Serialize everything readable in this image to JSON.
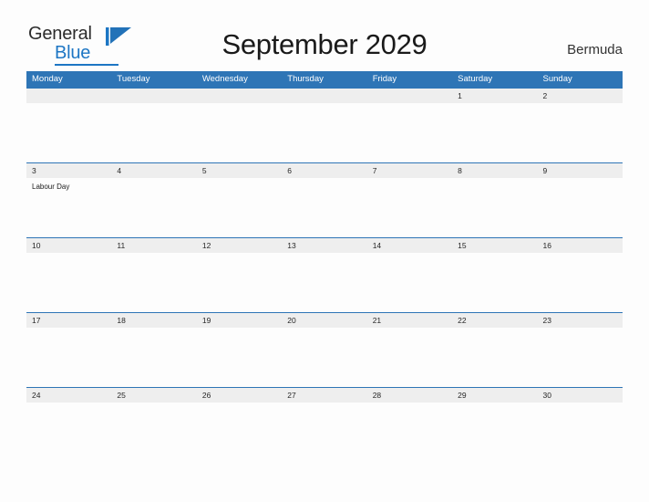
{
  "brand": {
    "word_one": "General",
    "word_two": "Blue",
    "flag_icon": "blue-triangle-flag",
    "color_blue": "#1d76c4",
    "color_dark": "#2b2b2b"
  },
  "header": {
    "title": "September 2029",
    "location": "Bermuda"
  },
  "theme": {
    "header_blue": "#2e75b6",
    "date_band_gray": "#eeeeee",
    "page_background": "#fdfdfd"
  },
  "calendar": {
    "weekdays": [
      "Monday",
      "Tuesday",
      "Wednesday",
      "Thursday",
      "Friday",
      "Saturday",
      "Sunday"
    ],
    "weeks": [
      {
        "dates": [
          "",
          "",
          "",
          "",
          "",
          "1",
          "2"
        ],
        "events": [
          "",
          "",
          "",
          "",
          "",
          "",
          ""
        ]
      },
      {
        "dates": [
          "3",
          "4",
          "5",
          "6",
          "7",
          "8",
          "9"
        ],
        "events": [
          "Labour Day",
          "",
          "",
          "",
          "",
          "",
          ""
        ]
      },
      {
        "dates": [
          "10",
          "11",
          "12",
          "13",
          "14",
          "15",
          "16"
        ],
        "events": [
          "",
          "",
          "",
          "",
          "",
          "",
          ""
        ]
      },
      {
        "dates": [
          "17",
          "18",
          "19",
          "20",
          "21",
          "22",
          "23"
        ],
        "events": [
          "",
          "",
          "",
          "",
          "",
          "",
          ""
        ]
      },
      {
        "dates": [
          "24",
          "25",
          "26",
          "27",
          "28",
          "29",
          "30"
        ],
        "events": [
          "",
          "",
          "",
          "",
          "",
          "",
          ""
        ]
      }
    ]
  }
}
